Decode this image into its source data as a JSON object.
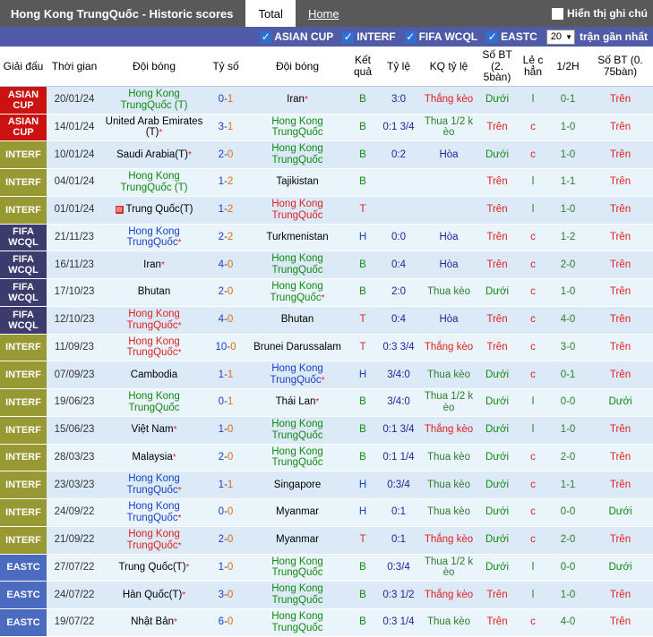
{
  "topbar": {
    "title": "Hong Kong TrungQuốc - Historic scores",
    "tab_total": "Total",
    "tab_home": "Home",
    "note_checkbox_label": "Hiển thị ghi chú",
    "checkbox_icon": "checkbox-unchecked-icon"
  },
  "filterbar": {
    "filters": [
      {
        "label": "ASIAN CUP",
        "checked": true
      },
      {
        "label": "INTERF",
        "checked": true
      },
      {
        "label": "FIFA WCQL",
        "checked": true
      },
      {
        "label": "EASTC",
        "checked": true
      }
    ],
    "count_value": "20",
    "count_suffix": "trận gần nhất",
    "dropdown_icon": "chevron-down-icon"
  },
  "colors": {
    "badge_asian_cup": "#cc1111",
    "badge_interf": "#989933",
    "badge_fifa_wcql": "#3b3b6d",
    "badge_eastc": "#4a6bc0",
    "topbar_bg": "#595959",
    "filterbar_bg": "#4f5ba6",
    "row_odd": "#dceaf7",
    "row_even": "#eaf4fb"
  },
  "table": {
    "headers": [
      "Giải đấu",
      "Thời gian",
      "Đội bóng",
      "Tỷ số",
      "Đội bóng",
      "Kết quả",
      "Tỷ lệ",
      "KQ tỷ lệ",
      "Số BT (2. 5bàn)",
      "Lẻ c hẳn",
      "1/2H",
      "Số BT (0. 75bàn)"
    ],
    "rows": [
      {
        "league": "ASIAN CUP",
        "league_type": "asian_cup",
        "date": "20/01/24",
        "home": "Hong Kong TrungQuốc (T)",
        "home_color": "green",
        "home_star": false,
        "score_l": "0",
        "score_r": "1",
        "away": "Iran",
        "away_color": "black",
        "away_star": true,
        "result": "B",
        "result_color": "green",
        "odds": "3:0",
        "odds_result": "Thắng kèo",
        "odds_result_color": "red",
        "ou25": "Dưới",
        "ou25_color": "green",
        "oddeven": "l",
        "oddeven_color": "green",
        "half": "0-1",
        "ou075": "Trên",
        "ou075_color": "red"
      },
      {
        "league": "ASIAN CUP",
        "league_type": "asian_cup",
        "date": "14/01/24",
        "home": "United Arab Emirates (T)",
        "home_color": "black",
        "home_star": true,
        "score_l": "3",
        "score_r": "1",
        "away": "Hong Kong TrungQuốc",
        "away_color": "green",
        "away_star": false,
        "result": "B",
        "result_color": "green",
        "odds": "0:1 3/4",
        "odds_result": "Thua 1/2 k èo",
        "odds_result_color": "dgreen",
        "ou25": "Trên",
        "ou25_color": "red",
        "oddeven": "c",
        "oddeven_color": "red",
        "half": "1-0",
        "ou075": "Trên",
        "ou075_color": "red"
      },
      {
        "league": "INTERF",
        "league_type": "interf",
        "date": "10/01/24",
        "home": "Saudi Arabia(T)",
        "home_color": "black",
        "home_star": true,
        "score_l": "2",
        "score_r": "0",
        "away": "Hong Kong TrungQuốc",
        "away_color": "green",
        "away_star": false,
        "result": "B",
        "result_color": "green",
        "odds": "0:2",
        "odds_result": "Hòa",
        "odds_result_color": "navy",
        "ou25": "Dưới",
        "ou25_color": "green",
        "oddeven": "c",
        "oddeven_color": "red",
        "half": "1-0",
        "ou075": "Trên",
        "ou075_color": "red"
      },
      {
        "league": "INTERF",
        "league_type": "interf",
        "date": "04/01/24",
        "home": "Hong Kong TrungQuốc (T)",
        "home_color": "green",
        "home_star": false,
        "score_l": "1",
        "score_r": "2",
        "away": "Tajikistan",
        "away_color": "black",
        "away_star": false,
        "result": "B",
        "result_color": "green",
        "odds": "",
        "odds_result": "",
        "odds_result_color": "black",
        "ou25": "Trên",
        "ou25_color": "red",
        "oddeven": "l",
        "oddeven_color": "green",
        "half": "1-1",
        "ou075": "Trên",
        "ou075_color": "red"
      },
      {
        "league": "INTERF",
        "league_type": "interf",
        "date": "01/01/24",
        "home": "Trung Quốc(T)",
        "home_color": "black",
        "home_star": false,
        "home_icon": "video-icon",
        "score_l": "1",
        "score_r": "2",
        "away": "Hong Kong TrungQuốc",
        "away_color": "red",
        "away_star": false,
        "result": "T",
        "result_color": "red",
        "odds": "",
        "odds_result": "",
        "odds_result_color": "black",
        "ou25": "Trên",
        "ou25_color": "red",
        "oddeven": "l",
        "oddeven_color": "green",
        "half": "1-0",
        "ou075": "Trên",
        "ou075_color": "red"
      },
      {
        "league": "FIFA WCQL",
        "league_type": "fifa_wcql",
        "date": "21/11/23",
        "home": "Hong Kong TrungQuốc",
        "home_color": "blue",
        "home_star": true,
        "score_l": "2",
        "score_r": "2",
        "away": "Turkmenistan",
        "away_color": "black",
        "away_star": false,
        "result": "H",
        "result_color": "blue",
        "odds": "0:0",
        "odds_result": "Hòa",
        "odds_result_color": "navy",
        "ou25": "Trên",
        "ou25_color": "red",
        "oddeven": "c",
        "oddeven_color": "red",
        "half": "1-2",
        "ou075": "Trên",
        "ou075_color": "red"
      },
      {
        "league": "FIFA WCQL",
        "league_type": "fifa_wcql",
        "date": "16/11/23",
        "home": "Iran",
        "home_color": "black",
        "home_star": true,
        "score_l": "4",
        "score_r": "0",
        "away": "Hong Kong TrungQuốc",
        "away_color": "green",
        "away_star": false,
        "result": "B",
        "result_color": "green",
        "odds": "0:4",
        "odds_result": "Hòa",
        "odds_result_color": "navy",
        "ou25": "Trên",
        "ou25_color": "red",
        "oddeven": "c",
        "oddeven_color": "red",
        "half": "2-0",
        "ou075": "Trên",
        "ou075_color": "red"
      },
      {
        "league": "FIFA WCQL",
        "league_type": "fifa_wcql",
        "date": "17/10/23",
        "home": "Bhutan",
        "home_color": "black",
        "home_star": false,
        "score_l": "2",
        "score_r": "0",
        "away": "Hong Kong TrungQuốc",
        "away_color": "green",
        "away_star": true,
        "result": "B",
        "result_color": "green",
        "odds": "2:0",
        "odds_result": "Thua kèo",
        "odds_result_color": "dgreen",
        "ou25": "Dưới",
        "ou25_color": "green",
        "oddeven": "c",
        "oddeven_color": "red",
        "half": "1-0",
        "ou075": "Trên",
        "ou075_color": "red"
      },
      {
        "league": "FIFA WCQL",
        "league_type": "fifa_wcql",
        "date": "12/10/23",
        "home": "Hong Kong TrungQuốc",
        "home_color": "red",
        "home_star": true,
        "score_l": "4",
        "score_r": "0",
        "away": "Bhutan",
        "away_color": "black",
        "away_star": false,
        "result": "T",
        "result_color": "red",
        "odds": "0:4",
        "odds_result": "Hòa",
        "odds_result_color": "navy",
        "ou25": "Trên",
        "ou25_color": "red",
        "oddeven": "c",
        "oddeven_color": "red",
        "half": "4-0",
        "ou075": "Trên",
        "ou075_color": "red"
      },
      {
        "league": "INTERF",
        "league_type": "interf",
        "date": "11/09/23",
        "home": "Hong Kong TrungQuốc",
        "home_color": "red",
        "home_star": true,
        "score_l": "10",
        "score_r": "0",
        "away": "Brunei Darussalam",
        "away_color": "black",
        "away_star": false,
        "result": "T",
        "result_color": "red",
        "odds": "0:3 3/4",
        "odds_result": "Thắng kèo",
        "odds_result_color": "red",
        "ou25": "Trên",
        "ou25_color": "red",
        "oddeven": "c",
        "oddeven_color": "red",
        "half": "3-0",
        "ou075": "Trên",
        "ou075_color": "red"
      },
      {
        "league": "INTERF",
        "league_type": "interf",
        "date": "07/09/23",
        "home": "Cambodia",
        "home_color": "black",
        "home_star": false,
        "score_l": "1",
        "score_r": "1",
        "away": "Hong Kong TrungQuốc",
        "away_color": "blue",
        "away_star": true,
        "result": "H",
        "result_color": "blue",
        "odds": "3/4:0",
        "odds_result": "Thua kèo",
        "odds_result_color": "dgreen",
        "ou25": "Dưới",
        "ou25_color": "green",
        "oddeven": "c",
        "oddeven_color": "red",
        "half": "0-1",
        "ou075": "Trên",
        "ou075_color": "red"
      },
      {
        "league": "INTERF",
        "league_type": "interf",
        "date": "19/06/23",
        "home": "Hong Kong TrungQuốc",
        "home_color": "green",
        "home_star": false,
        "score_l": "0",
        "score_r": "1",
        "away": "Thái Lan",
        "away_color": "black",
        "away_star": true,
        "result": "B",
        "result_color": "green",
        "odds": "3/4:0",
        "odds_result": "Thua 1/2 k èo",
        "odds_result_color": "dgreen",
        "ou25": "Dưới",
        "ou25_color": "green",
        "oddeven": "l",
        "oddeven_color": "green",
        "half": "0-0",
        "ou075": "Dưới",
        "ou075_color": "green"
      },
      {
        "league": "INTERF",
        "league_type": "interf",
        "date": "15/06/23",
        "home": "Việt Nam",
        "home_color": "black",
        "home_star": true,
        "score_l": "1",
        "score_r": "0",
        "away": "Hong Kong TrungQuốc",
        "away_color": "green",
        "away_star": false,
        "result": "B",
        "result_color": "green",
        "odds": "0:1 3/4",
        "odds_result": "Thắng kèo",
        "odds_result_color": "red",
        "ou25": "Dưới",
        "ou25_color": "green",
        "oddeven": "l",
        "oddeven_color": "green",
        "half": "1-0",
        "ou075": "Trên",
        "ou075_color": "red"
      },
      {
        "league": "INTERF",
        "league_type": "interf",
        "date": "28/03/23",
        "home": "Malaysia",
        "home_color": "black",
        "home_star": true,
        "score_l": "2",
        "score_r": "0",
        "away": "Hong Kong TrungQuốc",
        "away_color": "green",
        "away_star": false,
        "result": "B",
        "result_color": "green",
        "odds": "0:1 1/4",
        "odds_result": "Thua kèo",
        "odds_result_color": "dgreen",
        "ou25": "Dưới",
        "ou25_color": "green",
        "oddeven": "c",
        "oddeven_color": "red",
        "half": "2-0",
        "ou075": "Trên",
        "ou075_color": "red"
      },
      {
        "league": "INTERF",
        "league_type": "interf",
        "date": "23/03/23",
        "home": "Hong Kong TrungQuốc",
        "home_color": "blue",
        "home_star": true,
        "score_l": "1",
        "score_r": "1",
        "away": "Singapore",
        "away_color": "black",
        "away_star": false,
        "result": "H",
        "result_color": "blue",
        "odds": "0:3/4",
        "odds_result": "Thua kèo",
        "odds_result_color": "dgreen",
        "ou25": "Dưới",
        "ou25_color": "green",
        "oddeven": "c",
        "oddeven_color": "red",
        "half": "1-1",
        "ou075": "Trên",
        "ou075_color": "red"
      },
      {
        "league": "INTERF",
        "league_type": "interf",
        "date": "24/09/22",
        "home": "Hong Kong TrungQuốc",
        "home_color": "blue",
        "home_star": true,
        "score_l": "0",
        "score_r": "0",
        "away": "Myanmar",
        "away_color": "black",
        "away_star": false,
        "result": "H",
        "result_color": "blue",
        "odds": "0:1",
        "odds_result": "Thua kèo",
        "odds_result_color": "dgreen",
        "ou25": "Dưới",
        "ou25_color": "green",
        "oddeven": "c",
        "oddeven_color": "red",
        "half": "0-0",
        "ou075": "Dưới",
        "ou075_color": "green"
      },
      {
        "league": "INTERF",
        "league_type": "interf",
        "date": "21/09/22",
        "home": "Hong Kong TrungQuốc",
        "home_color": "red",
        "home_star": true,
        "score_l": "2",
        "score_r": "0",
        "away": "Myanmar",
        "away_color": "black",
        "away_star": false,
        "result": "T",
        "result_color": "red",
        "odds": "0:1",
        "odds_result": "Thắng kèo",
        "odds_result_color": "red",
        "ou25": "Dưới",
        "ou25_color": "green",
        "oddeven": "c",
        "oddeven_color": "red",
        "half": "2-0",
        "ou075": "Trên",
        "ou075_color": "red"
      },
      {
        "league": "EASTC",
        "league_type": "eastc",
        "date": "27/07/22",
        "home": "Trung Quốc(T)",
        "home_color": "black",
        "home_star": true,
        "score_l": "1",
        "score_r": "0",
        "away": "Hong Kong TrungQuốc",
        "away_color": "green",
        "away_star": false,
        "result": "B",
        "result_color": "green",
        "odds": "0:3/4",
        "odds_result": "Thua 1/2 k èo",
        "odds_result_color": "dgreen",
        "ou25": "Dưới",
        "ou25_color": "green",
        "oddeven": "l",
        "oddeven_color": "green",
        "half": "0-0",
        "ou075": "Dưới",
        "ou075_color": "green"
      },
      {
        "league": "EASTC",
        "league_type": "eastc",
        "date": "24/07/22",
        "home": "Hàn Quốc(T)",
        "home_color": "black",
        "home_star": true,
        "score_l": "3",
        "score_r": "0",
        "away": "Hong Kong TrungQuốc",
        "away_color": "green",
        "away_star": false,
        "result": "B",
        "result_color": "green",
        "odds": "0:3 1/2",
        "odds_result": "Thắng kèo",
        "odds_result_color": "red",
        "ou25": "Trên",
        "ou25_color": "red",
        "oddeven": "l",
        "oddeven_color": "green",
        "half": "1-0",
        "ou075": "Trên",
        "ou075_color": "red"
      },
      {
        "league": "EASTC",
        "league_type": "eastc",
        "date": "19/07/22",
        "home": "Nhật Bản",
        "home_color": "black",
        "home_star": true,
        "score_l": "6",
        "score_r": "0",
        "away": "Hong Kong TrungQuốc",
        "away_color": "green",
        "away_star": false,
        "result": "B",
        "result_color": "green",
        "odds": "0:3 1/4",
        "odds_result": "Thua kèo",
        "odds_result_color": "dgreen",
        "ou25": "Trên",
        "ou25_color": "red",
        "oddeven": "c",
        "oddeven_color": "red",
        "half": "4-0",
        "ou075": "Trên",
        "ou075_color": "red"
      }
    ]
  }
}
